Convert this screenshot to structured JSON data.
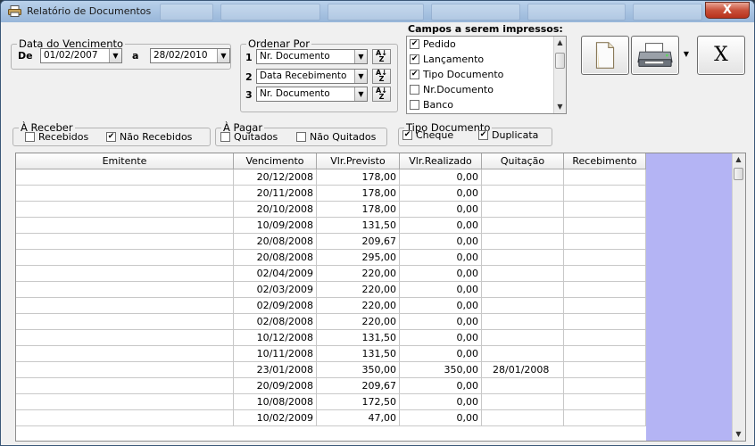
{
  "window": {
    "title": "Relatório de Documentos",
    "close_label": "X"
  },
  "vencimento": {
    "legend": "Data do Vencimento",
    "de_label": "De",
    "de_value": "01/02/2007",
    "a_label": "a",
    "a_value": "28/02/2010"
  },
  "ordenar": {
    "legend": "Ordenar Por",
    "items": [
      {
        "num": "1",
        "value": "Nr. Documento"
      },
      {
        "num": "2",
        "value": "Data Recebimento"
      },
      {
        "num": "3",
        "value": "Nr. Documento"
      }
    ],
    "sort_glyph_top": "A",
    "sort_glyph_bottom": "Z"
  },
  "campos": {
    "title": "Campos a serem impressos:",
    "items": [
      {
        "label": "Pedido",
        "checked": true
      },
      {
        "label": "Lançamento",
        "checked": true
      },
      {
        "label": "Tipo Documento",
        "checked": true
      },
      {
        "label": "Nr.Documento",
        "checked": false
      },
      {
        "label": "Banco",
        "checked": false
      }
    ]
  },
  "toolbar": {
    "close_label": "X"
  },
  "a_receber": {
    "legend": "À Receber",
    "recebidos": "Recebidos",
    "nao_recebidos": "Não Recebidos",
    "recebidos_checked": false,
    "nao_recebidos_checked": true
  },
  "a_pagar": {
    "legend": "À Pagar",
    "quitados": "Quitados",
    "nao_quitados": "Não Quitados",
    "quitados_checked": false,
    "nao_quitados_checked": false
  },
  "tipo_documento": {
    "legend": "Tipo Documento",
    "cheque": "Cheque",
    "duplicata": "Duplicata",
    "cheque_checked": true,
    "duplicata_checked": true
  },
  "grid": {
    "columns": [
      "Emitente",
      "Vencimento",
      "Vlr.Previsto",
      "Vlr.Realizado",
      "Quitação",
      "Recebimento"
    ],
    "rows": [
      [
        "",
        "20/12/2008",
        "178,00",
        "0,00",
        "",
        ""
      ],
      [
        "",
        "20/11/2008",
        "178,00",
        "0,00",
        "",
        ""
      ],
      [
        "",
        "20/10/2008",
        "178,00",
        "0,00",
        "",
        ""
      ],
      [
        "",
        "10/09/2008",
        "131,50",
        "0,00",
        "",
        ""
      ],
      [
        "",
        "20/08/2008",
        "209,67",
        "0,00",
        "",
        ""
      ],
      [
        "",
        "20/08/2008",
        "295,00",
        "0,00",
        "",
        ""
      ],
      [
        "",
        "02/04/2009",
        "220,00",
        "0,00",
        "",
        ""
      ],
      [
        "",
        "02/03/2009",
        "220,00",
        "0,00",
        "",
        ""
      ],
      [
        "",
        "02/09/2008",
        "220,00",
        "0,00",
        "",
        ""
      ],
      [
        "",
        "02/08/2008",
        "220,00",
        "0,00",
        "",
        ""
      ],
      [
        "",
        "10/12/2008",
        "131,50",
        "0,00",
        "",
        ""
      ],
      [
        "",
        "10/11/2008",
        "131,50",
        "0,00",
        "",
        ""
      ],
      [
        "",
        "23/01/2008",
        "350,00",
        "350,00",
        "28/01/2008",
        ""
      ],
      [
        "",
        "20/09/2008",
        "209,67",
        "0,00",
        "",
        ""
      ],
      [
        "",
        "10/08/2008",
        "172,50",
        "0,00",
        "",
        ""
      ],
      [
        "",
        "10/02/2009",
        "47,00",
        "0,00",
        "",
        ""
      ]
    ]
  }
}
